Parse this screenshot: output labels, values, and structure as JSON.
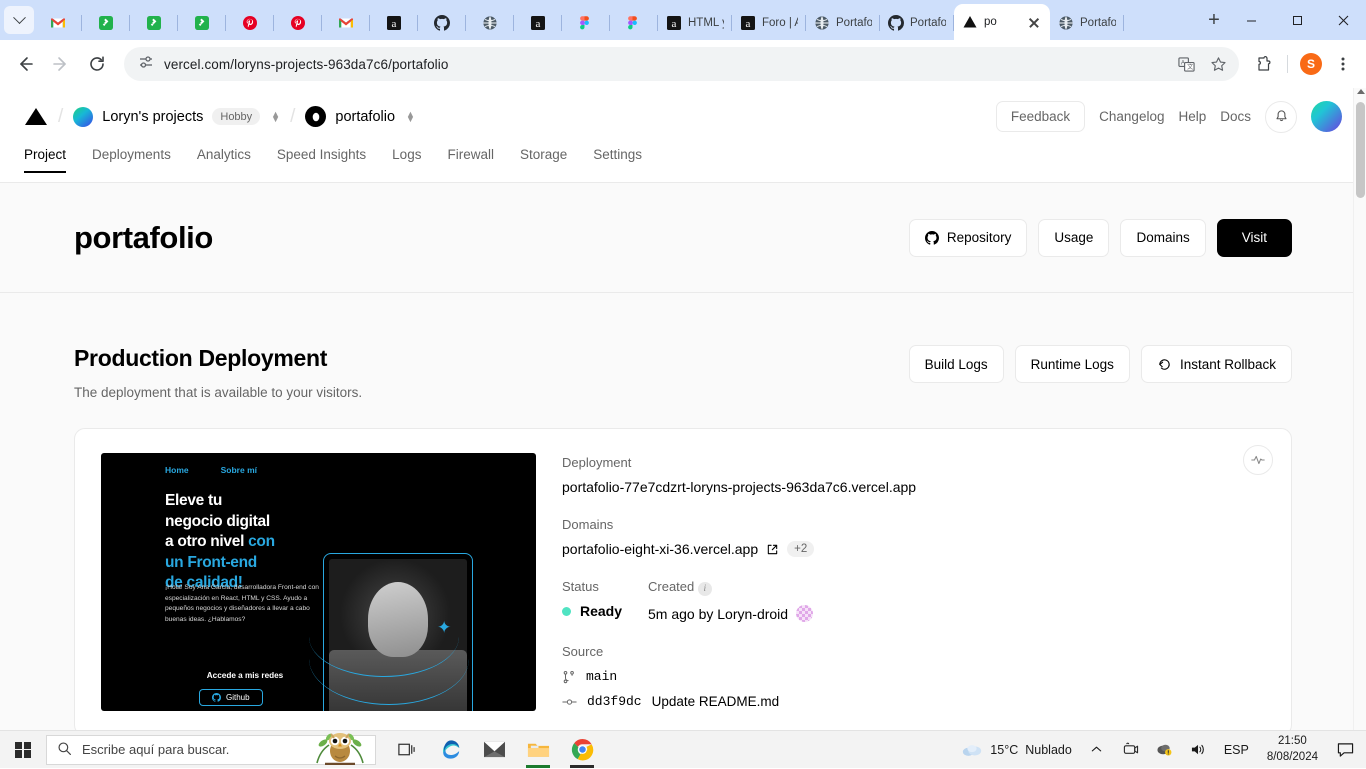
{
  "browser": {
    "tab_search_icon": "chevron-down-icon",
    "tabs": [
      {
        "favicon": "gmail-icon",
        "title": "",
        "active": false
      },
      {
        "favicon": "platzi-icon",
        "title": "",
        "active": false
      },
      {
        "favicon": "platzi-icon",
        "title": "",
        "active": false
      },
      {
        "favicon": "platzi-icon",
        "title": "",
        "active": false
      },
      {
        "favicon": "pinterest-icon",
        "title": "",
        "active": false
      },
      {
        "favicon": "pinterest-icon",
        "title": "",
        "active": false
      },
      {
        "favicon": "gmail-icon",
        "title": "",
        "active": false
      },
      {
        "favicon": "alura-icon",
        "title": "",
        "active": false
      },
      {
        "favicon": "github-icon",
        "title": "",
        "active": false
      },
      {
        "favicon": "globe-icon",
        "title": "",
        "active": false
      },
      {
        "favicon": "alura-icon",
        "title": "",
        "active": false
      },
      {
        "favicon": "figma-icon",
        "title": "",
        "active": false
      },
      {
        "favicon": "figma-icon",
        "title": "",
        "active": false
      },
      {
        "favicon": "alura-icon",
        "title": "HTML y",
        "active": false
      },
      {
        "favicon": "alura-icon",
        "title": "Foro | A",
        "active": false
      },
      {
        "favicon": "globe-icon",
        "title": "Portafo",
        "active": false
      },
      {
        "favicon": "github-icon",
        "title": "Portafo",
        "active": false
      },
      {
        "favicon": "vercel-icon",
        "title": "po",
        "active": true
      },
      {
        "favicon": "globe-icon",
        "title": "Portafo",
        "active": false
      }
    ],
    "new_tab_label": "+",
    "window_controls": {
      "minimize": "−",
      "maximize": "❐",
      "close": "✕"
    },
    "address": "vercel.com/loryns-projects-963da7c6/portafolio",
    "toolbar_icons": [
      "back-icon",
      "forward-icon",
      "reload-icon",
      "site-settings-icon",
      "translate-icon",
      "bookmark-star-icon",
      "extensions-icon",
      "profile-avatar",
      "chrome-menu-icon"
    ],
    "profile_initial": "S"
  },
  "vercel_header": {
    "logo": "vercel-triangle-logo",
    "team": {
      "name": "Loryn's projects",
      "plan": "Hobby"
    },
    "project": {
      "name": "portafolio"
    },
    "feedback_label": "Feedback",
    "links": [
      "Changelog",
      "Help",
      "Docs"
    ],
    "bell_icon": "notification-bell-icon",
    "nav": [
      {
        "label": "Project",
        "active": true
      },
      {
        "label": "Deployments",
        "active": false
      },
      {
        "label": "Analytics",
        "active": false
      },
      {
        "label": "Speed Insights",
        "active": false
      },
      {
        "label": "Logs",
        "active": false
      },
      {
        "label": "Firewall",
        "active": false
      },
      {
        "label": "Storage",
        "active": false
      },
      {
        "label": "Settings",
        "active": false
      }
    ]
  },
  "title_band": {
    "title": "portafolio",
    "buttons": [
      {
        "label": "Repository",
        "icon": "github-icon",
        "variant": "light"
      },
      {
        "label": "Usage",
        "icon": "",
        "variant": "light"
      },
      {
        "label": "Domains",
        "icon": "",
        "variant": "light"
      },
      {
        "label": "Visit",
        "icon": "",
        "variant": "dark"
      }
    ]
  },
  "production": {
    "title": "Production Deployment",
    "subtitle": "The deployment that is available to your visitors.",
    "actions": [
      {
        "label": "Build Logs",
        "icon": ""
      },
      {
        "label": "Runtime Logs",
        "icon": ""
      },
      {
        "label": "Instant Rollback",
        "icon": "rollback-icon"
      }
    ],
    "activity_icon": "activity-pulse-icon",
    "deployment_label": "Deployment",
    "deployment_url": "portafolio-77e7cdzrt-loryns-projects-963da7c6.vercel.app",
    "domains_label": "Domains",
    "domain_url": "portafolio-eight-xi-36.vercel.app",
    "domain_extra": "+2",
    "status_label": "Status",
    "status_value": "Ready",
    "status_color": "#50e3c2",
    "created_label": "Created",
    "created_value": "5m ago by Loryn-droid",
    "source_label": "Source",
    "branch": "main",
    "commit_hash": "dd3f9dc",
    "commit_message": "Update README.md"
  },
  "preview": {
    "nav": [
      "Home",
      "Sobre mí"
    ],
    "heading_white": "Eleve tu\nnegocio digital\na otro nivel",
    "heading_blue": "con\nun Front-end\nde calidad!",
    "paragraph": "¡Hola! Soy Ana Garcia, desarrolladora Front-end con especialización en React, HTML y CSS. Ayudo a pequeños negocios y diseñadores a llevar a cabo buenas ideas. ¿Hablamos?",
    "cta": "Accede a mis redes",
    "github_button": "Github",
    "accent_color": "#29a8e0"
  },
  "taskbar": {
    "start_icon": "windows-start-icon",
    "search_placeholder": "Escribe aquí para buscar.",
    "search_icon": "search-icon",
    "icons": [
      "task-view-icon",
      "edge-icon",
      "mail-icon",
      "file-explorer-icon",
      "chrome-icon"
    ],
    "weather_temp": "15°C",
    "weather_desc": "Nublado",
    "tray_icons": [
      "show-hidden-icons-icon",
      "onedrive-icon",
      "security-icon",
      "volume-icon"
    ],
    "language": "ESP",
    "time": "21:50",
    "date": "8/08/2024",
    "notification_icon": "action-center-icon"
  }
}
